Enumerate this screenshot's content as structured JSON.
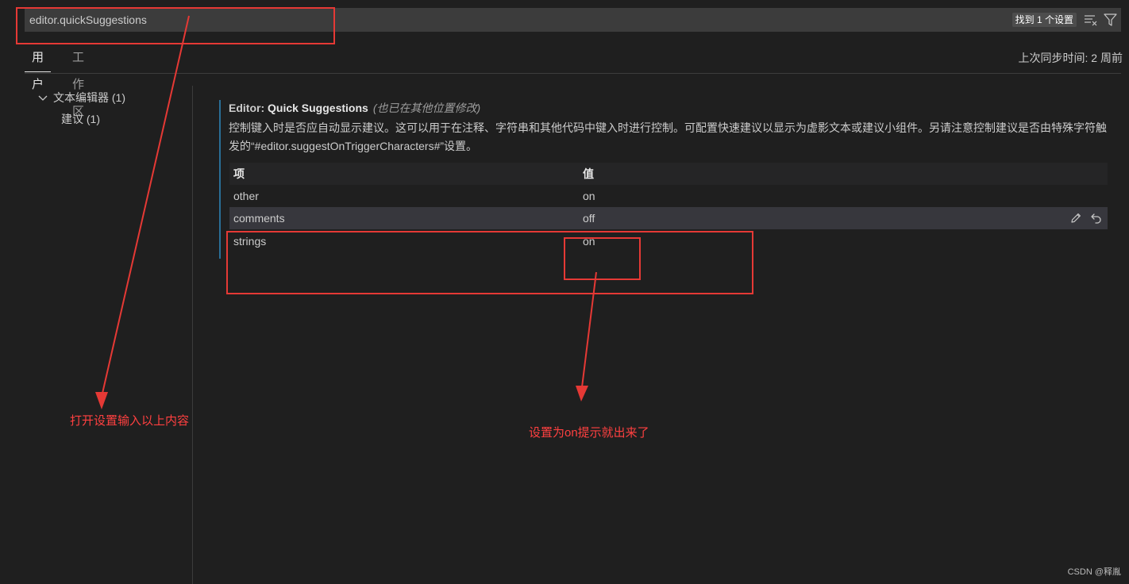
{
  "search": {
    "value": "editor.quickSuggestions",
    "result_count": "找到 1 个设置",
    "clear_filter_icon": "clear-filter-icon",
    "filter_icon": "filter-icon"
  },
  "tabs": [
    {
      "label": "用户",
      "active": true
    },
    {
      "label": "工作区",
      "active": false
    }
  ],
  "sync_status": "上次同步时间: 2 周前",
  "toc": [
    {
      "label": "文本编辑器 (1)",
      "expanded": true
    },
    {
      "label": "建议 (1)"
    }
  ],
  "setting": {
    "category": "Editor: ",
    "name": "Quick Suggestions",
    "note": "(也已在其他位置修改)",
    "description": "控制键入时是否应自动显示建议。这可以用于在注释、字符串和其他代码中键入时进行控制。可配置快速建议以显示为虚影文本或建议小组件。另请注意控制建议是否由特殊字符触发的“#editor.suggestOnTriggerCharacters#”设置。",
    "table": {
      "headers": {
        "key": "项",
        "value": "值"
      },
      "rows": [
        {
          "key": "other",
          "value": "on"
        },
        {
          "key": "comments",
          "value": "off"
        },
        {
          "key": "strings",
          "value": "on"
        }
      ]
    },
    "row_actions": {
      "edit_icon": "pencil-icon",
      "reset_icon": "undo-icon"
    }
  },
  "annotations": {
    "left_note": "打开设置输入以上内容",
    "right_note": "设置为on提示就出来了",
    "color": "#e53935"
  },
  "watermark": "CSDN @释胤",
  "colors": {
    "background": "#1f1f1f",
    "input_background": "#3c3c3c",
    "hover_row": "#37373d",
    "modified_bar": "#2a6f97"
  }
}
